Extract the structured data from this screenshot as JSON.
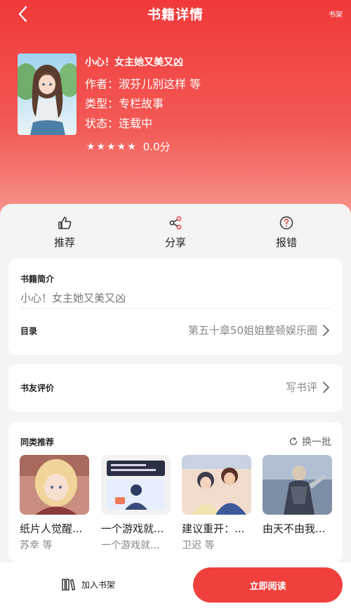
{
  "nav": {
    "title": "书籍详情",
    "right_label": "书架"
  },
  "book": {
    "title": "小心！女主她又美又凶",
    "author_line": "作者：淑芬儿别这样 等",
    "type_line": "类型：专栏故事",
    "status_line": "状态：连载中",
    "stars": "★★★★★",
    "score": "0.0分"
  },
  "actions": [
    {
      "label": "推荐",
      "icon": "thumbs-up-icon"
    },
    {
      "label": "分享",
      "icon": "share-icon"
    },
    {
      "label": "报错",
      "icon": "question-circle-icon"
    }
  ],
  "intro": {
    "label": "书籍简介",
    "text": "小心！女主她又美又凶",
    "toc_label": "目录",
    "toc_value": "第五十章50姐姐整顿娱乐圈"
  },
  "review": {
    "label": "书友评价",
    "action": "写书评"
  },
  "recommend": {
    "label": "同类推荐",
    "refresh": "换一批",
    "items": [
      {
        "title": "纸片人觉醒...",
        "author": "苏幸 等"
      },
      {
        "title": "一个游戏就...",
        "author": "一个游戏就..."
      },
      {
        "title": "建议重开：...",
        "author": "卫迟 等"
      },
      {
        "title": "由天不由我...",
        "author": ""
      }
    ]
  },
  "bottom": {
    "shelf_label": "加入书架",
    "read_label": "立即阅读"
  },
  "colors": {
    "accent": "#f0403d",
    "hero_top": "#f0383a",
    "hero_bottom": "#f6a59d"
  }
}
